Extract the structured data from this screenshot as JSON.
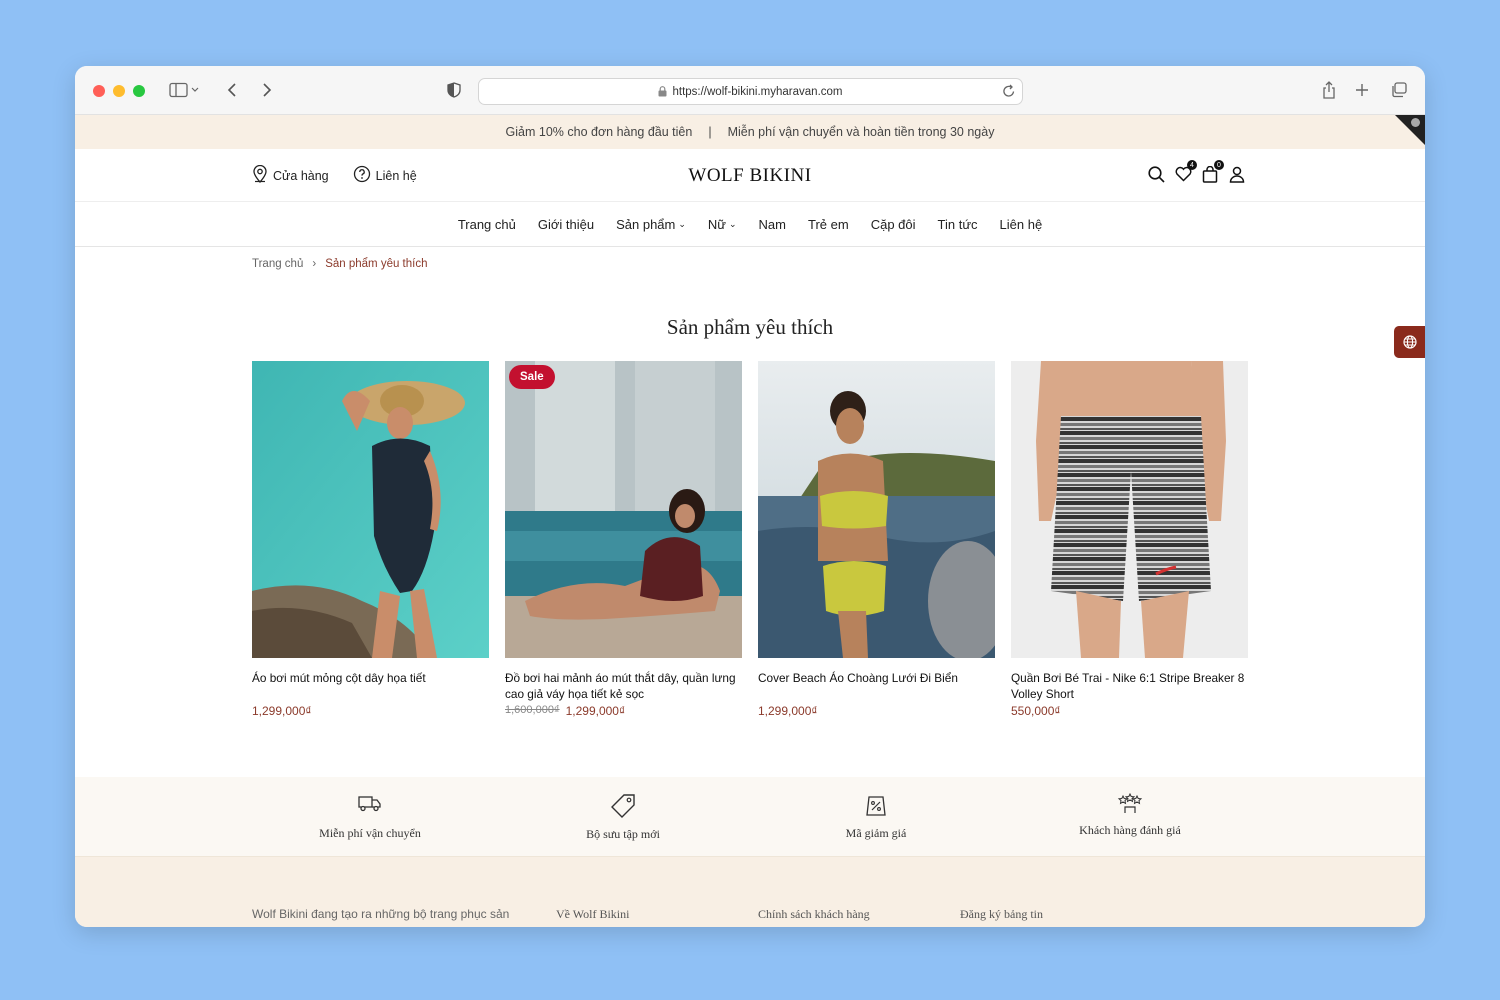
{
  "browser": {
    "url": "https://wolf-bikini.myharavan.com"
  },
  "announcement": {
    "left": "Giảm 10% cho đơn hàng đầu tiên",
    "separator": "|",
    "right": "Miễn phí vận chuyển và hoàn tiền trong 30 ngày"
  },
  "header": {
    "store_label": "Cửa hàng",
    "contact_label": "Liên hệ",
    "logo": "WOLF BIKINI",
    "wishlist_count": "4",
    "cart_count": "0"
  },
  "nav": {
    "items": [
      "Trang chủ",
      "Giới thiệu",
      "Sản phẩm",
      "Nữ",
      "Nam",
      "Trẻ em",
      "Cặp đôi",
      "Tin tức",
      "Liên hệ"
    ]
  },
  "breadcrumb": {
    "home": "Trang chủ",
    "separator": "›",
    "current": "Sản phẩm yêu thích"
  },
  "page_title": "Sản phẩm yêu thích",
  "products": [
    {
      "name": "Áo bơi mút mỏng cột dây họa tiết",
      "old_price": "",
      "price": "1,299,000₫",
      "sale": ""
    },
    {
      "name": "Đồ bơi hai mảnh áo mút thắt dây, quần lưng cao giả váy họa tiết kẻ sọc",
      "old_price": "1,600,000₫",
      "price": "1,299,000₫",
      "sale": "Sale"
    },
    {
      "name": "Cover Beach Áo Choàng Lưới Đi Biển",
      "old_price": "",
      "price": "1,299,000₫",
      "sale": ""
    },
    {
      "name": "Quần Bơi Bé Trai - Nike 6:1 Stripe Breaker 8 Volley Short",
      "old_price": "",
      "price": "550,000₫",
      "sale": ""
    }
  ],
  "features": [
    {
      "label": "Miễn phí vận chuyển",
      "icon": "truck-icon"
    },
    {
      "label": "Bộ sưu tập mới",
      "icon": "tag-icon"
    },
    {
      "label": "Mã giảm giá",
      "icon": "discount-icon"
    },
    {
      "label": "Khách hàng đánh giá",
      "icon": "stars-icon"
    }
  ],
  "footer": {
    "about_text": "Wolf Bikini đang tạo ra những bộ trang phục sản",
    "col1": "Về Wolf Bikini",
    "col2": "Chính sách khách hàng",
    "col3": "Đăng ký bảng tin"
  },
  "colors": {
    "accent": "#8b3a2b",
    "sale": "#c3102f",
    "announce_bg": "#f8efe4"
  }
}
